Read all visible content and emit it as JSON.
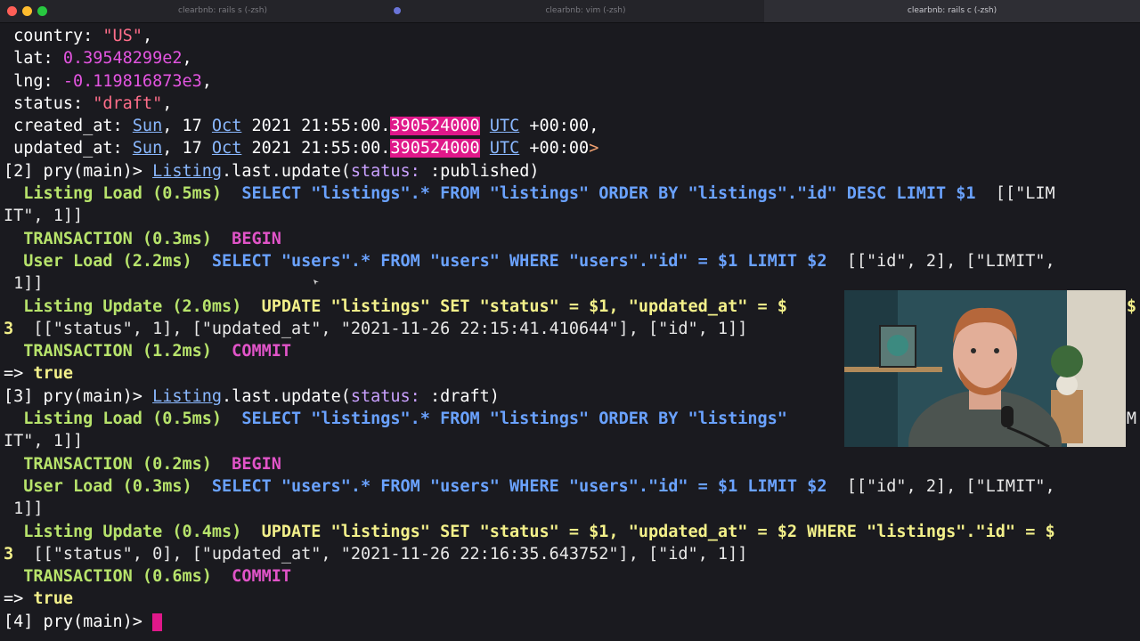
{
  "window": {
    "tabs": [
      {
        "label": "clearbnb: rails s (-zsh)"
      },
      {
        "label": "clearbnb: vim (-zsh)"
      },
      {
        "label": "clearbnb: rails c (-zsh)"
      }
    ]
  },
  "output": {
    "country_key": " country: ",
    "country_val": "\"US\"",
    "country_end": ",",
    "lat_key": " lat: ",
    "lat_val": "0.39548299e2",
    "lat_end": ",",
    "lng_key": " lng: ",
    "lng_val": "-0.119816873e3",
    "lng_end": ",",
    "status_key": " status: ",
    "status_val": "\"draft\"",
    "status_end": ",",
    "created_key": " created_at: ",
    "updated_key": " updated_at: ",
    "day": "Sun",
    "comma_sp": ", ",
    "date_day": "17 ",
    "month": "Oct",
    "time": " 2021 21:55:00.",
    "nanos": "390524000",
    "sp": " ",
    "utc": "UTC",
    "offset": " +00:00",
    "end_comma": ",",
    "end_arrow": ">"
  },
  "cmd2": {
    "prompt": "[2] pry(main)> ",
    "cls": "Listing",
    "mid": ".last.update(",
    "kwkey": "status:",
    "kwval": " :published",
    "close": ")",
    "l1_label": "  Listing Load (0.5ms)",
    "l1_sql": "  SELECT \"listings\".* FROM \"listings\" ORDER BY \"listings\".\"id\" DESC LIMIT $1",
    "l1_bind": "  [[\"LIM",
    "l2": "IT\", 1]]",
    "l3_label": "  TRANSACTION (0.3ms)",
    "l3_kw": "  BEGIN",
    "l4_label": "  User Load (2.2ms)",
    "l4_sql": "  SELECT \"users\".* FROM \"users\" WHERE \"users\".\"id\" = $1 LIMIT $2",
    "l4_bind": "  [[\"id\", 2], [\"LIMIT\",",
    "l5": " 1]]",
    "l6_label": "  Listing Update (2.0ms)",
    "l6_sql": "  UPDATE \"listings\" SET \"status\" = $1, \"updated_at\" = $",
    "l6_tail": "$",
    "l7_num": "3",
    "l7_rest": "  [[\"status\", 1], [\"updated_at\", \"2021-11-26 22:15:41.410644\"], [\"id\", 1]]",
    "l8_label": "  TRANSACTION (1.2ms)",
    "l8_kw": "  COMMIT",
    "result_arrow": "=> ",
    "result_val": "true"
  },
  "cmd3": {
    "prompt": "[3] pry(main)> ",
    "cls": "Listing",
    "mid": ".last.update(",
    "kwkey": "status:",
    "kwval": " :draft",
    "close": ")",
    "l1_label": "  Listing Load (0.5ms)",
    "l1_sql": "  SELECT \"listings\".* FROM \"listings\" ORDER BY \"listings\"",
    "l1_tail": "M",
    "l2": "IT\", 1]]",
    "l3_label": "  TRANSACTION (0.2ms)",
    "l3_kw": "  BEGIN",
    "l4_label": "  User Load (0.3ms)",
    "l4_sql": "  SELECT \"users\".* FROM \"users\" WHERE \"users\".\"id\" = $1 LIMIT $2",
    "l4_bind": "  [[\"id\", 2], [\"LIMIT\",",
    "l5": " 1]]",
    "l6_label": "  Listing Update (0.4ms)",
    "l6_sql": "  UPDATE \"listings\" SET \"status\" = $1, \"updated_at\" = $2 WHERE \"listings\".\"id\" = $",
    "l7_num": "3",
    "l7_rest": "  [[\"status\", 0], [\"updated_at\", \"2021-11-26 22:16:35.643752\"], [\"id\", 1]]",
    "l8_label": "  TRANSACTION (0.6ms)",
    "l8_kw": "  COMMIT",
    "result_arrow": "=> ",
    "result_val": "true"
  },
  "cmd4": {
    "prompt": "[4] pry(main)> "
  },
  "colors": {
    "accent": "#e0188a",
    "background": "#1a1a1f",
    "sql": "#6aa2ff",
    "label": "#b7e36b"
  }
}
